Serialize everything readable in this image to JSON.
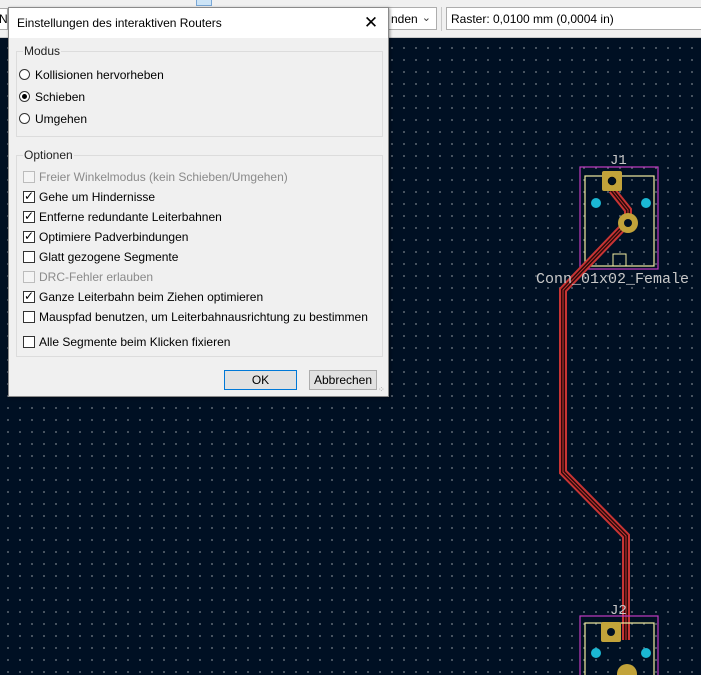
{
  "toolbar": {
    "left_stub_text": "N",
    "dropdown_value": "nden",
    "grid_label": "Raster: 0,0100 mm (0,0004 in)"
  },
  "dialog": {
    "title": "Einstellungen des interaktiven Routers",
    "close_glyph": "✕",
    "mode_group": {
      "label": "Modus",
      "options": [
        {
          "label": "Kollisionen hervorheben",
          "checked": false
        },
        {
          "label": "Schieben",
          "checked": true
        },
        {
          "label": "Umgehen",
          "checked": false
        }
      ]
    },
    "options_group": {
      "label": "Optionen",
      "options": [
        {
          "label": "Freier Winkelmodus (kein Schieben/Umgehen)",
          "checked": false,
          "disabled": true
        },
        {
          "label": "Gehe um Hindernisse",
          "checked": true,
          "disabled": false
        },
        {
          "label": "Entferne redundante Leiterbahnen",
          "checked": true,
          "disabled": false
        },
        {
          "label": "Optimiere Padverbindungen",
          "checked": true,
          "disabled": false
        },
        {
          "label": "Glatt gezogene Segmente",
          "checked": false,
          "disabled": false
        },
        {
          "label": "DRC-Fehler erlauben",
          "checked": false,
          "disabled": true
        },
        {
          "label": "Ganze Leiterbahn beim Ziehen optimieren",
          "checked": true,
          "disabled": false
        },
        {
          "label": "Mauspfad benutzen, um Leiterbahnausrichtung zu bestimmen",
          "checked": false,
          "disabled": false
        },
        {
          "label": "Alle Segmente beim Klicken fixieren",
          "checked": false,
          "disabled": false
        }
      ]
    },
    "ok_label": "OK",
    "cancel_label": "Abbrechen"
  },
  "pcb": {
    "ref_top": "J1",
    "value_top": "Conn_01x02_Female",
    "ref_bottom": "J2",
    "colors": {
      "background": "#001023",
      "courtyard": "#c23bc2",
      "silkscreen": "#f2eda1",
      "pad": "#c2a33a",
      "track": "#c83434",
      "mounting": "#1bb8d4",
      "text": "#c8c8c8"
    }
  }
}
